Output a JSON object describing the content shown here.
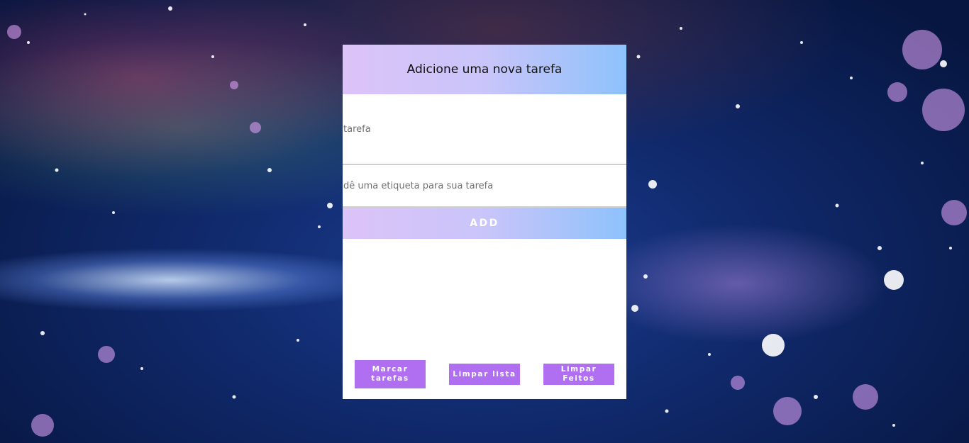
{
  "card": {
    "title": "Adicione uma nova tarefa",
    "task_placeholder": "tarefa",
    "task_value": "",
    "tag_placeholder": "dê uma etiqueta para sua tarefa",
    "tag_value": "",
    "add_label": "ADD"
  },
  "actions": {
    "mark_label": "Marcar tarefas",
    "clear_list_label": "Limpar lista",
    "clear_done_label": "Limpar Feitos"
  },
  "colors": {
    "header_gradient_start": "#dcc3f8",
    "header_gradient_end": "#8ec2fb",
    "action_button": "#b06ff0"
  }
}
